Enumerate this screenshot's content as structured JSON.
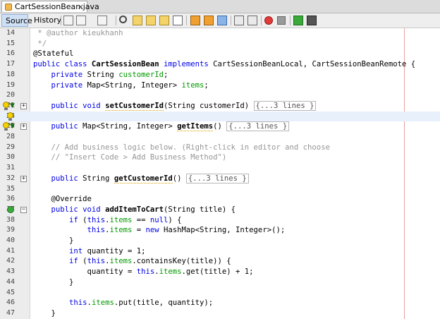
{
  "tab": {
    "title": "CartSessionBean.java",
    "close_label": "×"
  },
  "toolbar": {
    "source_label": "Source",
    "history_label": "History"
  },
  "lines": [
    {
      "num": "14"
    },
    {
      "num": "15"
    },
    {
      "num": "16"
    },
    {
      "num": "17"
    },
    {
      "num": "18"
    },
    {
      "num": "19"
    },
    {
      "num": "20"
    },
    {
      "num": "21"
    },
    {
      "num": "24"
    },
    {
      "num": "25"
    },
    {
      "num": "28"
    },
    {
      "num": "29"
    },
    {
      "num": "30"
    },
    {
      "num": "31"
    },
    {
      "num": "32"
    },
    {
      "num": "35"
    },
    {
      "num": "36"
    },
    {
      "num": "37"
    },
    {
      "num": "38"
    },
    {
      "num": "39"
    },
    {
      "num": "40"
    },
    {
      "num": "41"
    },
    {
      "num": "42"
    },
    {
      "num": "43"
    },
    {
      "num": "44"
    },
    {
      "num": "45"
    },
    {
      "num": "46"
    },
    {
      "num": "47"
    }
  ],
  "code": {
    "l14": " * @author kieukhanh",
    "l15": " */",
    "l16": "@Stateful",
    "l17a": "public class ",
    "l17b": "CartSessionBean",
    "l17c": " implements ",
    "l17d": "CartSessionBeanLocal, CartSessionBeanRemote {",
    "l18a": "    private ",
    "l18b": "String ",
    "l18c": "customerId",
    "l18d": ";",
    "l19a": "    private ",
    "l19b": "Map<String, Integer> ",
    "l19c": "items",
    "l19d": ";",
    "l21a": "    public void ",
    "l21b": "setCustomerId",
    "l21c": "(String customerId) ",
    "l21d": "{...3 lines }",
    "l25a": "    public ",
    "l25b": "Map<String, Integer> ",
    "l25c": "getItems",
    "l25d": "() ",
    "l25e": "{...3 lines }",
    "l29": "    // Add business logic below. (Right-click in editor and choose",
    "l30": "    // \"Insert Code > Add Business Method\")",
    "l32a": "    public ",
    "l32b": "String ",
    "l32c": "getCustomerId",
    "l32d": "() ",
    "l32e": "{...3 lines }",
    "l36": "    @Override",
    "l37a": "    public void ",
    "l37b": "addItemToCart",
    "l37c": "(String title) {",
    "l38a": "        if ",
    "l38b": "(",
    "l38c": "this",
    "l38d": ".",
    "l38e": "items",
    "l38f": " == ",
    "l38g": "null",
    "l38h": ") {",
    "l39a": "            ",
    "l39b": "this",
    "l39c": ".",
    "l39d": "items",
    "l39e": " = ",
    "l39f": "new ",
    "l39g": "HashMap<String, Integer>();",
    "l40": "        }",
    "l41a": "        int ",
    "l41b": "quantity = 1;",
    "l42a": "        if ",
    "l42b": "(",
    "l42c": "this",
    "l42d": ".",
    "l42e": "items",
    "l42f": ".containsKey(title)) {",
    "l43a": "            quantity = ",
    "l43b": "this",
    "l43c": ".",
    "l43d": "items",
    "l43e": ".get(title) + 1;",
    "l44": "        }",
    "l46a": "        ",
    "l46b": "this",
    "l46c": ".",
    "l46d": "items",
    "l46e": ".put(title, quantity);",
    "l47": "    }"
  },
  "colors": {
    "keyword": "#0000e6",
    "comment": "#969696",
    "field": "#009900",
    "margin": "#e8a0a0",
    "highlight": "#e8f0fb"
  }
}
